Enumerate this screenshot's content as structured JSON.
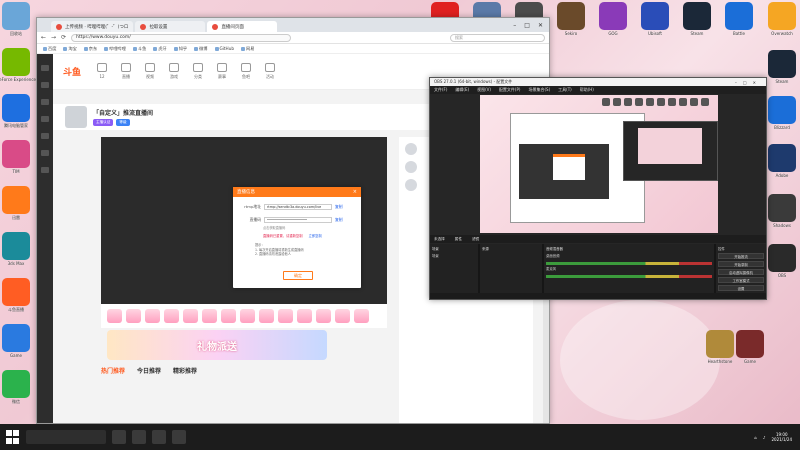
{
  "desktop": {
    "left_icons": [
      {
        "label": "回收站",
        "color": "#6aa6d8"
      },
      {
        "label": "GeForce Experience",
        "color": "#76b900"
      },
      {
        "label": "腾讯电脑管家",
        "color": "#1e6fe0"
      },
      {
        "label": "TIM",
        "color": "#d94b87"
      },
      {
        "label": "迅雷",
        "color": "#ff7a1a"
      },
      {
        "label": "3ds Max",
        "color": "#1b8b9a"
      },
      {
        "label": "斗鱼直播",
        "color": "#ff5d23"
      },
      {
        "label": "Game",
        "color": "#2a7ae0"
      },
      {
        "label": "微信",
        "color": "#2bb24c"
      }
    ],
    "top_icons": [
      {
        "label": "网易云音乐",
        "color": "#e02020"
      },
      {
        "label": "FC3",
        "color": "#5b7aa8"
      },
      {
        "label": "Arma",
        "color": "#4c4c4c"
      },
      {
        "label": "Sekiro",
        "color": "#6a4a2a"
      },
      {
        "label": "GOG",
        "color": "#8a3ab8"
      },
      {
        "label": "Ubisoft",
        "color": "#2a4db8"
      },
      {
        "label": "Steam",
        "color": "#1b2838"
      },
      {
        "label": "Battle",
        "color": "#1b6ed8"
      }
    ],
    "right_icons": [
      {
        "label": "Overwatch",
        "color": "#f5a623"
      },
      {
        "label": "Steam",
        "color": "#1b2838"
      },
      {
        "label": "Blizzard",
        "color": "#1b6ed8"
      },
      {
        "label": "Adobe",
        "color": "#1e3a6d"
      },
      {
        "label": "Shadows",
        "color": "#3a3a3a"
      },
      {
        "label": "OBS",
        "color": "#2a2a2a"
      },
      {
        "label": "Hearthstone",
        "color": "#b08a3a"
      },
      {
        "label": "Game",
        "color": "#7a2a2a"
      }
    ]
  },
  "browser": {
    "tabs": [
      {
        "label": "上传视频 · 哔哩哔哩(゜-゜)つロ"
      },
      {
        "label": "拉取设置"
      },
      {
        "label": "直播间页面"
      }
    ],
    "url": "https://www.douyu.com/",
    "search_placeholder": "搜索",
    "bookmarks": [
      "百度",
      "淘宝",
      "京东",
      "哔哩哔哩",
      "斗鱼",
      "虎牙",
      "知乎",
      "微博",
      "GitHub",
      "网易"
    ],
    "site": {
      "logo": "斗鱼",
      "nav": [
        "12",
        "直播",
        "视频",
        "游戏",
        "分类",
        "赛事",
        "鱼吧",
        "活动"
      ],
      "room_title": "「自定义」推流直播间",
      "room_tags": [
        "主播认证",
        "等级"
      ],
      "subtabs": [
        "热门推荐",
        "今日推荐",
        "精彩推荐"
      ],
      "banner": "礼物派送"
    }
  },
  "dialog": {
    "title": "直播信息",
    "close": "×",
    "server_label": "rtmp地址",
    "server_value": "rtmp://sendtc3a.douyu.com/live",
    "copy1": "复制",
    "key_label": "直播码",
    "key_value": "••••••••••••••••••••",
    "copy2": "复制",
    "note": "点击获取直播码",
    "warn": "直播码已重置，请重新复制",
    "warn_copy": "立即复制",
    "tips": [
      "提示：",
      "1. 每次开启直播将重新生成直播码",
      "2. 直播码请勿泄露给他人"
    ],
    "ok": "确定"
  },
  "obs": {
    "title": "OBS 27.0.1 (64-bit, windows) - 配置文件",
    "menu": [
      "文件(F)",
      "编辑(E)",
      "视图(V)",
      "配置文件(P)",
      "场景集合(S)",
      "工具(T)",
      "帮助(H)"
    ],
    "bar": [
      "未选择",
      "属性",
      "滤镜"
    ],
    "docks": {
      "scenes": "场景",
      "scene_item": "场景",
      "sources": "来源",
      "mixer": "音频混音器",
      "mixer_items": [
        "桌面音频",
        "麦克风"
      ],
      "controls_title": "控件",
      "controls": [
        "开始推流",
        "开始录制",
        "启动虚拟摄像机",
        "工作室模式",
        "设置",
        "退出"
      ]
    }
  },
  "taskbar": {
    "time": "19:00",
    "date": "2021/1/24"
  }
}
